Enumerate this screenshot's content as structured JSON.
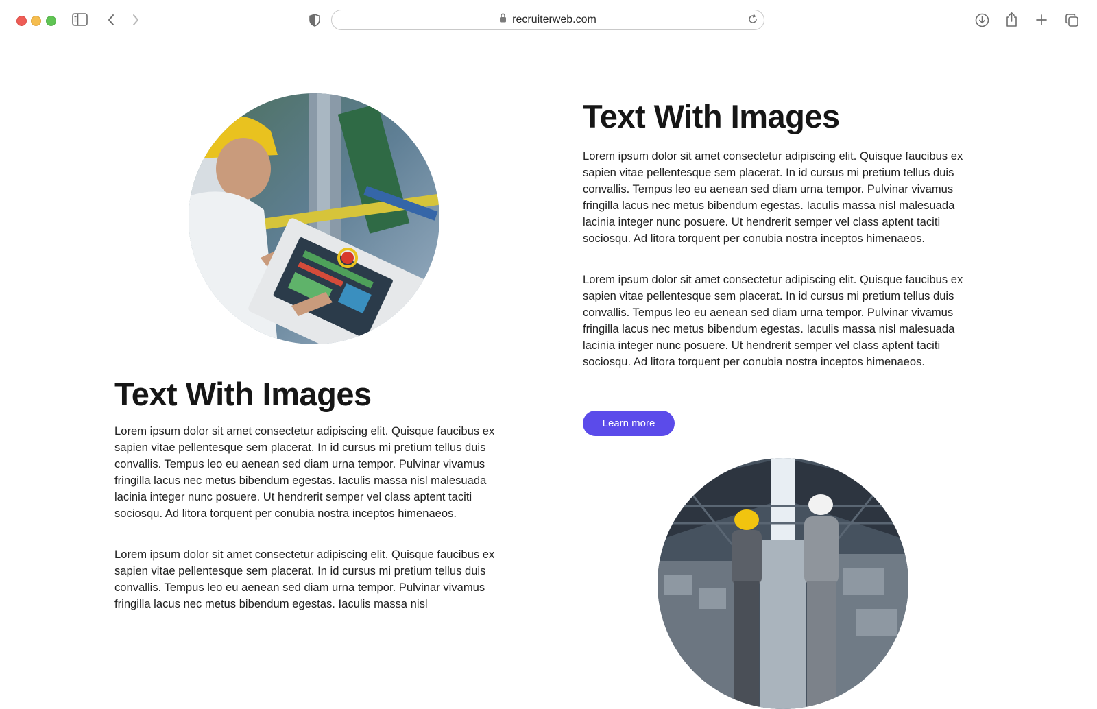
{
  "browser": {
    "url": "recruiterweb.com",
    "icons": [
      "sidebar-icon",
      "back-icon",
      "forward-icon",
      "privacy-shield-icon",
      "lock-icon",
      "reload-icon",
      "download-icon",
      "share-icon",
      "new-tab-icon",
      "tabs-overview-icon"
    ]
  },
  "section_left": {
    "image_alt": "Worker in hard hat operating a touchscreen control panel",
    "heading": "Text With Images",
    "paragraphs": [
      "Lorem ipsum dolor sit amet consectetur adipiscing elit. Quisque faucibus ex sapien vitae pellentesque sem placerat. In id cursus mi pretium tellus duis convallis. Tempus leo eu aenean sed diam urna tempor. Pulvinar vivamus fringilla lacus nec metus bibendum egestas. Iaculis massa nisl malesuada lacinia integer nunc posuere. Ut hendrerit semper vel class aptent taciti sociosqu. Ad litora torquent per conubia nostra inceptos himenaeos.",
      "Lorem ipsum dolor sit amet consectetur adipiscing elit. Quisque faucibus ex sapien vitae pellentesque sem placerat. In id cursus mi pretium tellus duis convallis. Tempus leo eu aenean sed diam urna tempor. Pulvinar vivamus fringilla lacus nec metus bibendum egestas. Iaculis massa nisl"
    ]
  },
  "section_right": {
    "heading": "Text With Images",
    "paragraphs": [
      "Lorem ipsum dolor sit amet consectetur adipiscing elit. Quisque faucibus ex sapien vitae pellentesque sem placerat. In id cursus mi pretium tellus duis convallis. Tempus leo eu aenean sed diam urna tempor. Pulvinar vivamus fringilla lacus nec metus bibendum egestas. Iaculis massa nisl malesuada lacinia integer nunc posuere. Ut hendrerit semper vel class aptent taciti sociosqu. Ad litora torquent per conubia nostra inceptos himenaeos.",
      "Lorem ipsum dolor sit amet consectetur adipiscing elit. Quisque faucibus ex sapien vitae pellentesque sem placerat. In id cursus mi pretium tellus duis convallis. Tempus leo eu aenean sed diam urna tempor. Pulvinar vivamus fringilla lacus nec metus bibendum egestas. Iaculis massa nisl malesuada lacinia integer nunc posuere. Ut hendrerit semper vel class aptent taciti sociosqu. Ad litora torquent per conubia nostra inceptos himenaeos."
    ],
    "button_label": "Learn more",
    "image_alt": "Two workers in hard hats inside a warehouse"
  },
  "colors": {
    "accent": "#5b4bea",
    "heading": "#161616",
    "body_text": "#222222"
  }
}
